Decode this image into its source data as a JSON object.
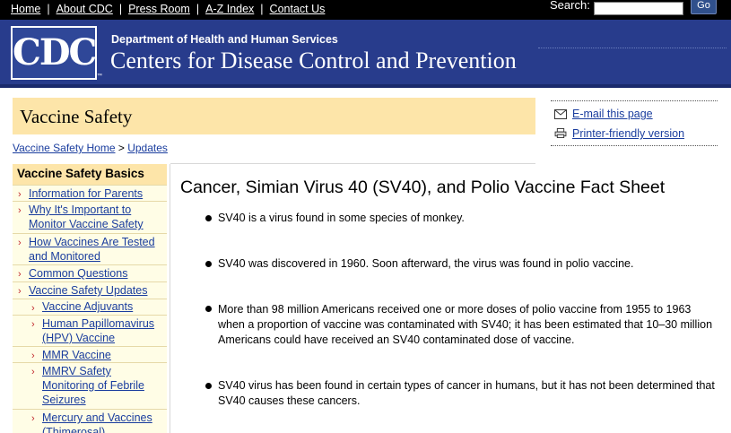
{
  "topnav": {
    "links": [
      "Home",
      "About CDC",
      "Press Room",
      "A-Z Index",
      "Contact Us"
    ],
    "separator": "|",
    "search_label": "Search:",
    "go_label": "Go"
  },
  "header": {
    "logo_text": "CDC",
    "logo_tm": "™",
    "department": "Department of Health and Human Services",
    "agency": "Centers for Disease Control and Prevention"
  },
  "page": {
    "title": "Vaccine Safety"
  },
  "utilities": {
    "email_label": "E-mail this page",
    "email_icon": "envelope-icon",
    "print_label": "Printer-friendly version",
    "print_icon": "printer-icon"
  },
  "breadcrumb": {
    "home": "Vaccine Safety Home",
    "separator": ">",
    "current": "Updates"
  },
  "sidebar": {
    "heading": "Vaccine Safety Basics",
    "chevron": "›",
    "items": [
      {
        "label": "Information for Parents"
      },
      {
        "label": "Why It's Important to Monitor Vaccine Safety"
      },
      {
        "label": "How Vaccines Are Tested and Monitored"
      },
      {
        "label": "Common Questions"
      },
      {
        "label": "Vaccine Safety Updates"
      },
      {
        "label": "Vaccine Adjuvants"
      },
      {
        "label": "Human Papillomavirus (HPV) Vaccine"
      },
      {
        "label": "MMR Vaccine"
      },
      {
        "label": "MMRV Safety Monitoring of Febrile Seizures"
      },
      {
        "label": "Mercury and Vaccines (Thimerosal)"
      }
    ]
  },
  "main": {
    "heading": "Cancer, Simian Virus 40 (SV40), and Polio Vaccine Fact Sheet",
    "bullets": [
      "SV40 is a virus found in some species of monkey.",
      "SV40 was discovered in 1960. Soon afterward, the virus was found in polio vaccine.",
      "More than 98 million Americans received one or more doses of polio vaccine from 1955 to 1963 when a proportion of vaccine was contaminated with SV40; it has been estimated that 10–30 million Americans could have received an SV40 contaminated dose of vaccine.",
      "SV40 virus has been found in certain types of cancer in humans, but it has not been determined that SV40 causes these cancers."
    ]
  },
  "colors": {
    "header_blue": "#283c8c",
    "link_blue": "#1a3d9e",
    "title_band": "#fde5a9",
    "sidebar_bg": "#fffde6",
    "chevron_red": "#c1272d"
  }
}
